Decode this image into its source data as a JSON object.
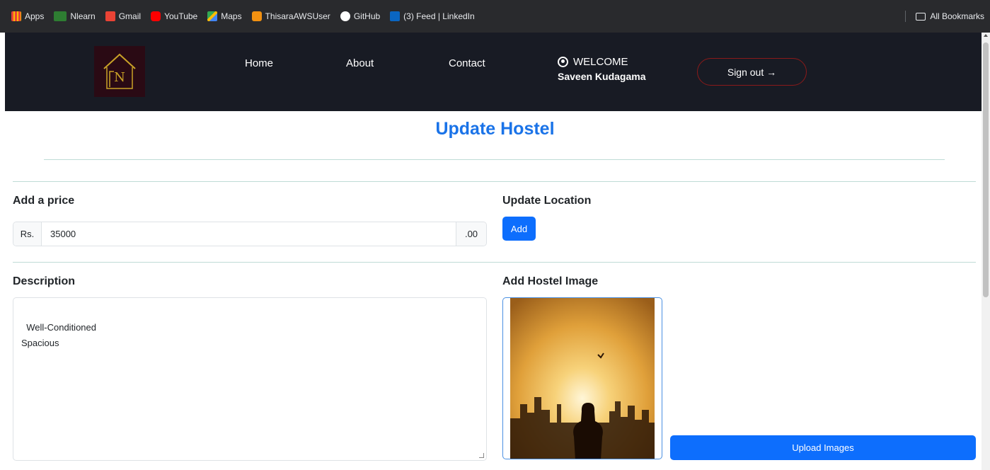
{
  "bookmarks": {
    "items": [
      {
        "label": "Apps",
        "icon": "apps-grid-icon"
      },
      {
        "label": "Nlearn",
        "icon": "nlearn-icon"
      },
      {
        "label": "Gmail",
        "icon": "gmail-icon"
      },
      {
        "label": "YouTube",
        "icon": "youtube-icon"
      },
      {
        "label": "Maps",
        "icon": "maps-icon"
      },
      {
        "label": "ThisaraAWSUser",
        "icon": "aws-icon"
      },
      {
        "label": "GitHub",
        "icon": "github-icon"
      },
      {
        "label": "(3) Feed | LinkedIn",
        "icon": "linkedin-icon"
      }
    ],
    "all_bookmarks": "All Bookmarks"
  },
  "navbar": {
    "links": [
      "Home",
      "About",
      "Contact"
    ],
    "welcome": "WELCOME",
    "user_name": "Saveen Kudagama",
    "signout": "Sign out →",
    "logo_letter": "N"
  },
  "page": {
    "title": "Update Hostel"
  },
  "price": {
    "label": "Add a price",
    "prefix": "Rs.",
    "value": "35000",
    "suffix": ".00"
  },
  "location": {
    "label": "Update Location",
    "add_button": "Add"
  },
  "description": {
    "label": "Description",
    "value": "Well-Conditioned\nSpacious"
  },
  "image": {
    "label": "Add Hostel Image",
    "upload_button": "Upload Images"
  },
  "colors": {
    "primary": "#0d6efd",
    "title": "#1a73e8",
    "navbar": "#181b24",
    "signout_border": "#8b1a1a"
  }
}
